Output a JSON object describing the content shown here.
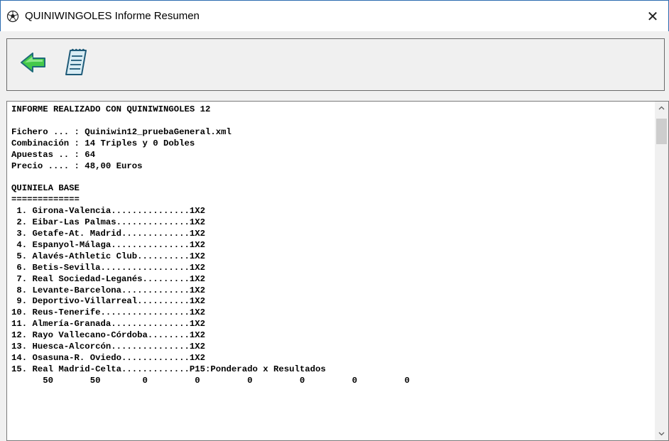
{
  "window": {
    "title": "QUINIWINGOLES Informe Resumen",
    "close_glyph": "✕",
    "icon": "soccer-ball-icon"
  },
  "toolbar": {
    "back_icon": "green-left-arrow-icon",
    "notepad_icon": "notepad-icon"
  },
  "report": {
    "header": "INFORME REALIZADO CON QUINIWINGOLES 12",
    "info": [
      "Fichero ... : Quiniwin12_pruebaGeneral.xml",
      "Combinación : 14 Triples y 0 Dobles",
      "Apuestas .. : 64",
      "Precio .... : 48,00 Euros"
    ],
    "section_title": "QUINIELA BASE",
    "section_underline": "=============",
    "matches": [
      " 1. Girona-Valencia...............1X2",
      " 2. Eibar-Las Palmas..............1X2",
      " 3. Getafe-At. Madrid.............1X2",
      " 4. Espanyol-Málaga...............1X2",
      " 5. Alavés-Athletic Club..........1X2",
      " 6. Betis-Sevilla.................1X2",
      " 7. Real Sociedad-Leganés.........1X2",
      " 8. Levante-Barcelona.............1X2",
      " 9. Deportivo-Villarreal..........1X2",
      "10. Reus-Tenerife.................1X2",
      "11. Almería-Granada...............1X2",
      "12. Rayo Vallecano-Córdoba........1X2",
      "13. Huesca-Alcorcón...............1X2",
      "14. Osasuna-R. Oviedo.............1X2",
      "15. Real Madrid-Celta.............P15:Ponderado x Resultados"
    ],
    "p15_values": "      50       50        0         0         0         0         0         0"
  },
  "scrollbar": {
    "up_glyph": "⌃",
    "down_glyph": "⌄"
  }
}
